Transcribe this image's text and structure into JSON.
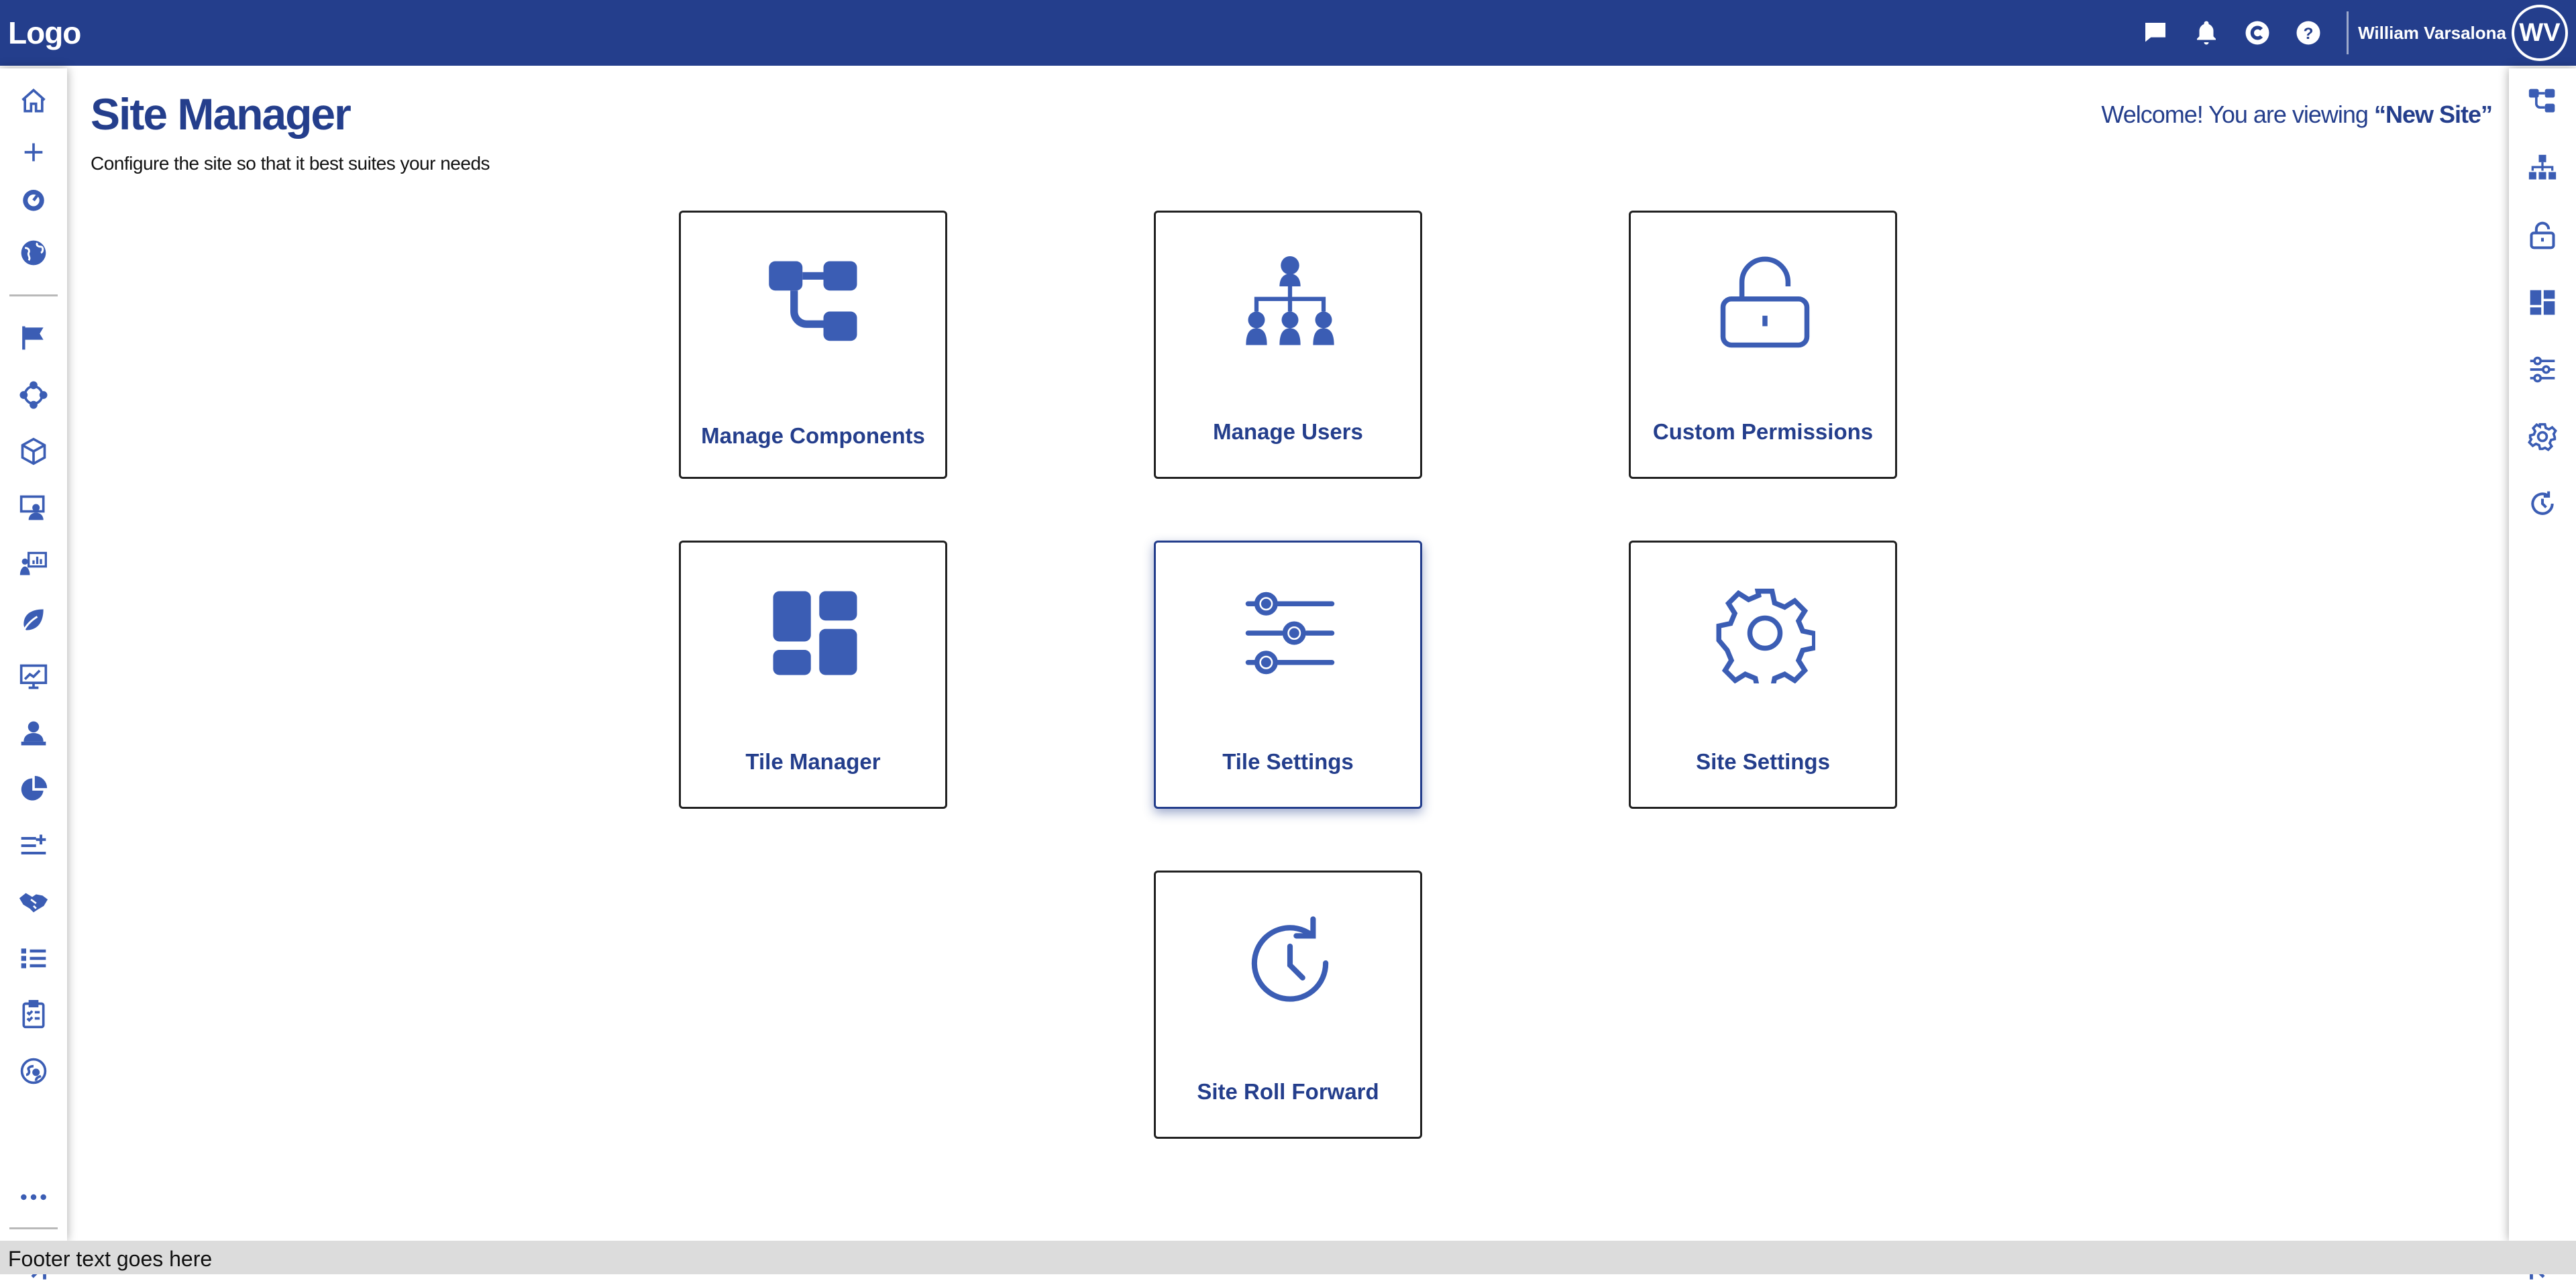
{
  "topbar": {
    "logo": "Logo",
    "icons": [
      "chat-icon",
      "bell-icon",
      "c-circle-icon",
      "help-icon"
    ],
    "user_name": "William Varsalona",
    "user_initials": "WV"
  },
  "colors": {
    "brand": "#243e8c",
    "icon": "#3b5db4",
    "footer_bg": "#dcdcdc"
  },
  "left_sidebar": {
    "icons": [
      "home-icon",
      "plus-icon",
      "gauge-icon",
      "globe-icon",
      "flag-icon",
      "cycle-icon",
      "cube-icon",
      "presenter-icon",
      "presentation-chart-icon",
      "leaf-icon",
      "monitor-chart-icon",
      "user-desk-icon",
      "pie-chart-icon",
      "list-add-icon",
      "handshake-icon",
      "list-icon",
      "clipboard-checklist-icon",
      "globe-network-icon",
      "more-icon",
      "expand-icon"
    ]
  },
  "right_sidebar": {
    "icons": [
      "components-icon",
      "org-chart-icon",
      "unlock-icon",
      "tiles-icon",
      "sliders-icon",
      "gear-icon",
      "roll-forward-icon",
      "collapse-icon"
    ]
  },
  "main": {
    "title": "Site Manager",
    "subtitle": "Configure the site so that it best suites your needs",
    "welcome_prefix": "Welcome! You are viewing ",
    "site_name": "“New Site”"
  },
  "tiles": [
    {
      "label": "Manage Components",
      "icon": "components-icon"
    },
    {
      "label": "Manage Users",
      "icon": "org-chart-icon"
    },
    {
      "label": "Custom Permissions",
      "icon": "unlock-icon"
    },
    {
      "label": "Tile Manager",
      "icon": "tiles-icon"
    },
    {
      "label": "Tile Settings",
      "icon": "sliders-icon",
      "active": true
    },
    {
      "label": "Site Settings",
      "icon": "gear-icon"
    },
    {
      "label": "Site Roll Forward",
      "icon": "roll-forward-icon"
    }
  ],
  "footer": {
    "text": "Footer text goes here"
  }
}
